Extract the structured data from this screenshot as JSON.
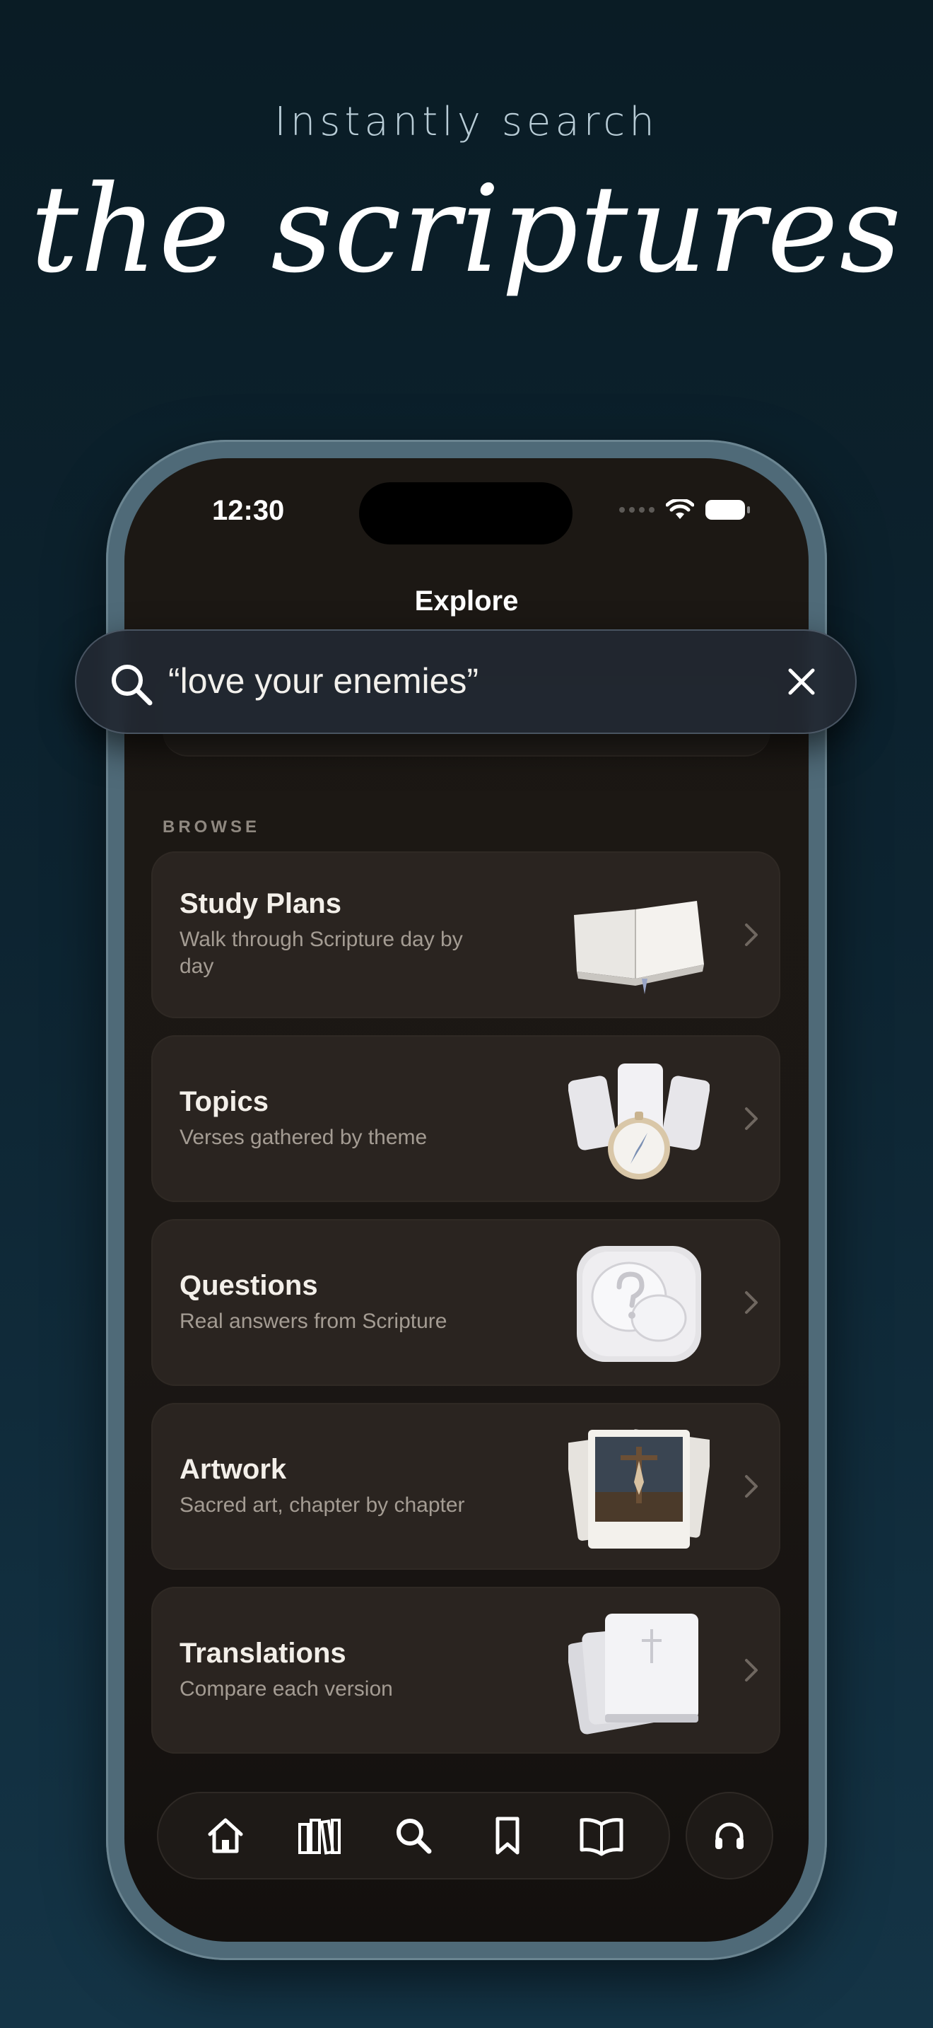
{
  "headline": {
    "small": "Instantly search",
    "large": "the scriptures"
  },
  "status_bar": {
    "time": "12:30"
  },
  "nav": {
    "title": "Explore"
  },
  "search": {
    "value": "“love your enemies”"
  },
  "browse": {
    "label": "BROWSE",
    "items": [
      {
        "title": "Study Plans",
        "subtitle": "Walk through Scripture day by day",
        "icon": "open-book-icon"
      },
      {
        "title": "Topics",
        "subtitle": "Verses gathered by theme",
        "icon": "compass-cards-icon"
      },
      {
        "title": "Questions",
        "subtitle": "Real answers from Scripture",
        "icon": "question-bubble-icon"
      },
      {
        "title": "Artwork",
        "subtitle": "Sacred art, chapter by chapter",
        "icon": "photo-frames-icon"
      },
      {
        "title": "Translations",
        "subtitle": "Compare each version",
        "icon": "stacked-bibles-icon"
      }
    ]
  },
  "tab_bar": {
    "tabs": [
      "home-icon",
      "library-icon",
      "search-icon",
      "bookmark-icon",
      "book-icon"
    ],
    "audio": "headphones-icon"
  },
  "colors": {
    "background": "#0d2431",
    "screen": "#1c1814",
    "card": "#2a2420",
    "frame": "#4f6a78",
    "text_primary": "#f3efe9",
    "text_secondary": "#a49c93"
  }
}
